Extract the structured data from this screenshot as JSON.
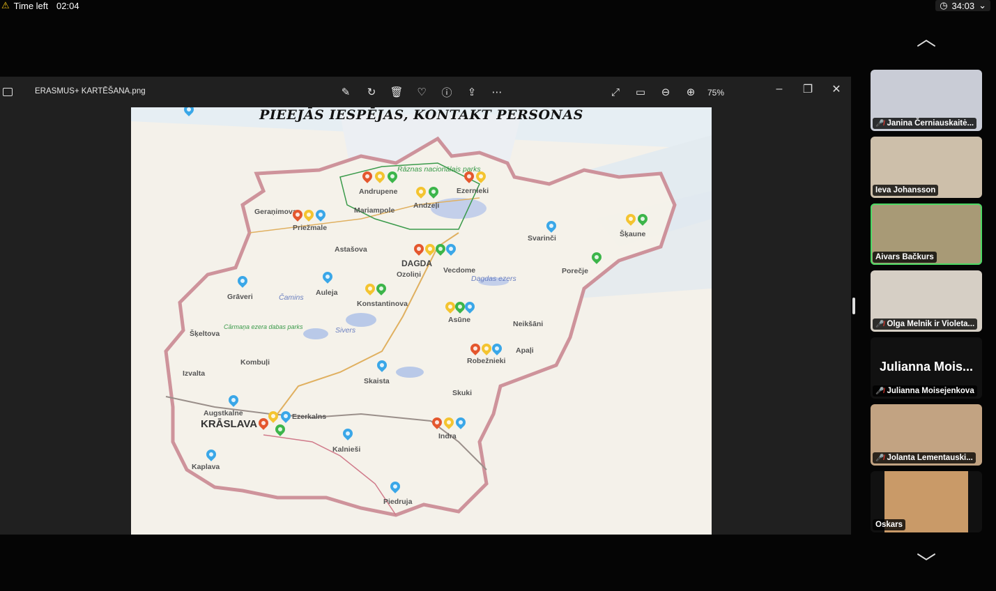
{
  "meeting": {
    "time_left_label": "Time left",
    "time_left_value": "02:04",
    "timer_value": "34:03",
    "timer_chevron": "⌄"
  },
  "viewer": {
    "file_name": "ERASMUS+ KARTĒŠANA.png",
    "zoom": "75%"
  },
  "map": {
    "title": "PIEEJĀS IESPĒJAS, KONTAKT PERSONAS",
    "places": {
      "andrupene": "Andrupene",
      "ezernieki": "Ezernieki",
      "andzeli": "Andzeļi",
      "geranimova": "Geraņimova",
      "priezmale": "Priežmale",
      "mariampole": "Mariampole",
      "astasova": "Astašova",
      "dagda": "DAGDA",
      "vecdome": "Vecdome",
      "ozolini": "Ozoliņi",
      "svarinci": "Svarinči",
      "skaune": "Šķaune",
      "porecje": "Porečje",
      "graveri": "Grāveri",
      "auleja": "Auleja",
      "konstantinova": "Konstantinova",
      "asune": "Asūne",
      "neiksani": "Neikšāni",
      "apalj": "Apaļi",
      "skeltova": "Šķeltova",
      "robeznieki": "Robežnieki",
      "kombuli": "Kombuļi",
      "izvalta": "Izvalta",
      "skaista": "Skaista",
      "skuki": "Skuki",
      "augstkalne": "Augstkalne",
      "kraslava": "KRĀSLAVA",
      "ezerkalns": "Ezerkalns",
      "indra": "Indra",
      "kalniesi": "Kalnieši",
      "kaplava": "Kaplava",
      "piedruja": "Piedruja",
      "raznas_park": "Rāznas nacionālais parks",
      "dagdas_ezers": "Dagdas ezers",
      "sivers": "Sivers",
      "caminš": "Čamins",
      "cirmanas": "Cārmaņa ezera dabas parks"
    }
  },
  "participants": [
    {
      "name": "Janina Černiauskaitė...",
      "muted": true
    },
    {
      "name": "Ieva Johansson",
      "muted": false
    },
    {
      "name": "Aivars Bačkurs",
      "muted": false,
      "active": true
    },
    {
      "name": "Olga Melnik ir Violeta...",
      "muted": true
    },
    {
      "name": "Julianna Moisejenkova",
      "big_label": "Julianna Mois...",
      "muted": true
    },
    {
      "name": "Jolanta Lementauski...",
      "muted": true
    },
    {
      "name": "Oskars",
      "muted": false
    }
  ],
  "icons": {
    "warning": "warning-icon",
    "clock": "clock-icon",
    "scroll_up": "chevron-up-icon",
    "scroll_down": "chevron-down-icon"
  }
}
